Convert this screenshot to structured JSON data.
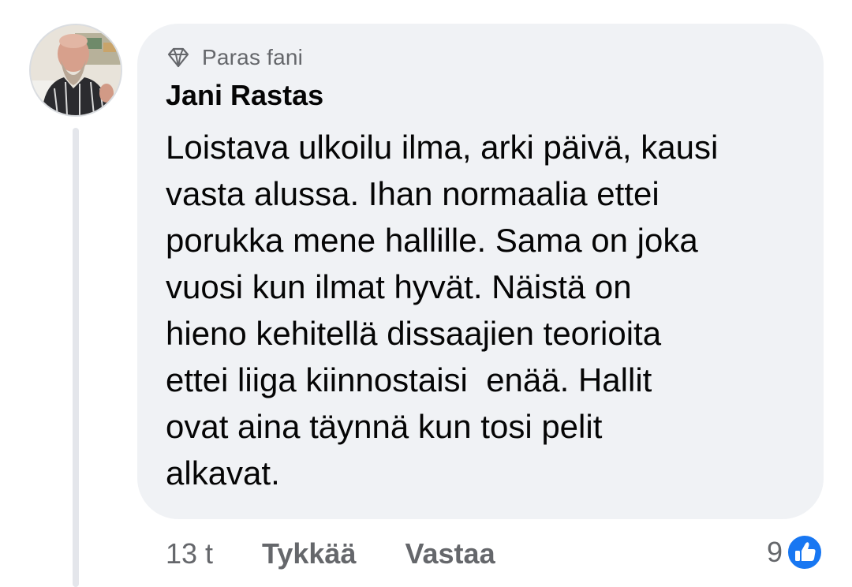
{
  "comment": {
    "badge": {
      "icon": "diamond-icon",
      "label": "Paras fani"
    },
    "author": "Jani Rastas",
    "text": "Loistava ulkoilu ilma, arki päivä, kausi\nvasta alussa. Ihan normaalia ettei\nporukka mene hallille. Sama on joka\nvuosi kun ilmat hyvät. Näistä on\nhieno kehitellä dissaajien teorioita\nettei liiga kiinnostaisi  enää. Hallit\novat aina täynnä kun tosi pelit\nalkavat.",
    "avatar_alt": "Jani Rastas",
    "actions": {
      "time": "13 t",
      "like_label": "Tykkää",
      "reply_label": "Vastaa"
    },
    "reactions": {
      "count": "9",
      "icon": "like-thumb-icon",
      "color": "#1877f2"
    }
  },
  "colors": {
    "bubble": "#f0f2f5",
    "text": "#050505",
    "secondary": "#65676b",
    "thread_line": "#e4e6eb"
  }
}
